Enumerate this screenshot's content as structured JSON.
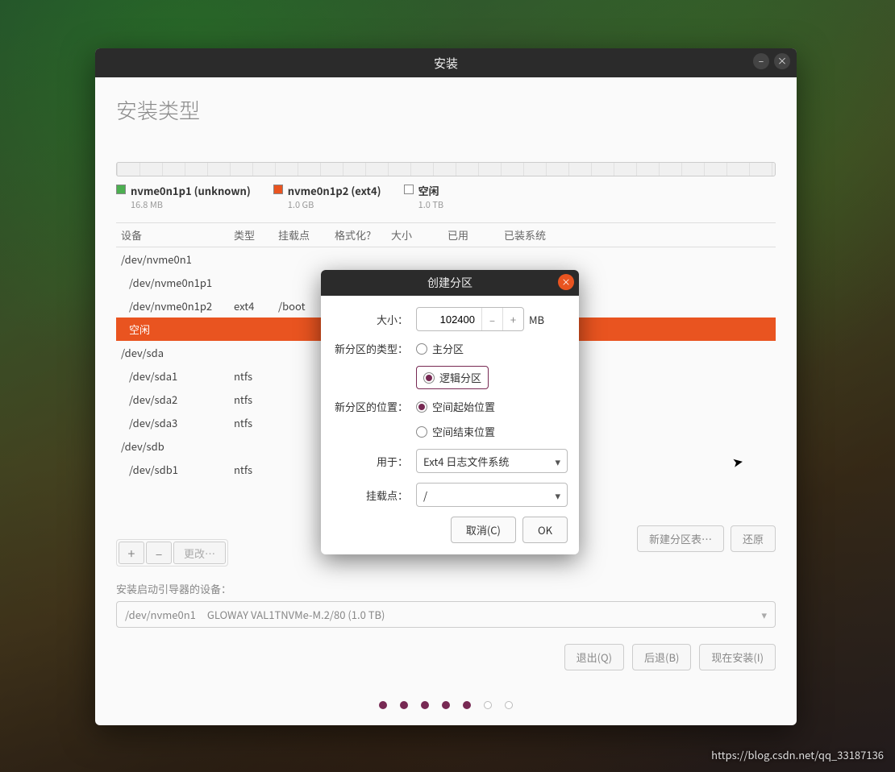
{
  "window": {
    "title": "安装",
    "minimize": "–",
    "close": "×"
  },
  "page": {
    "title": "安装类型"
  },
  "legend": [
    {
      "color": "green",
      "name": "nvme0n1p1 (unknown)",
      "size": "16.8 MB"
    },
    {
      "color": "orange",
      "name": "nvme0n1p2 (ext4)",
      "size": "1.0 GB"
    },
    {
      "color": "empty",
      "name": "空闲",
      "size": "1.0 TB"
    }
  ],
  "columns": {
    "device": "设备",
    "type": "类型",
    "mount": "挂载点",
    "format": "格式化?",
    "size": "大小",
    "used": "已用",
    "system": "已装系统"
  },
  "rows": [
    {
      "indent": 0,
      "device": "/dev/nvme0n1"
    },
    {
      "indent": 1,
      "device": "/dev/nvme0n1p1"
    },
    {
      "indent": 1,
      "device": "/dev/nvme0n1p2",
      "type": "ext4",
      "mount": "/boot"
    },
    {
      "indent": 1,
      "device": "空闲",
      "selected": true
    },
    {
      "indent": 0,
      "device": "/dev/sda"
    },
    {
      "indent": 1,
      "device": "/dev/sda1",
      "type": "ntfs"
    },
    {
      "indent": 1,
      "device": "/dev/sda2",
      "type": "ntfs"
    },
    {
      "indent": 1,
      "device": "/dev/sda3",
      "type": "ntfs"
    },
    {
      "indent": 0,
      "device": "/dev/sdb"
    },
    {
      "indent": 1,
      "device": "/dev/sdb1",
      "type": "ntfs"
    }
  ],
  "toolbar": {
    "plus": "+",
    "minus": "–",
    "change": "更改…",
    "new_table": "新建分区表…",
    "revert": "还原"
  },
  "bootloader": {
    "label": "安装启动引导器的设备：",
    "device": "/dev/nvme0n1",
    "desc": "GLOWAY VAL1TNVMe-M.2/80 (1.0 TB)"
  },
  "footer": {
    "quit": "退出(Q)",
    "back": "后退(B)",
    "install": "现在安装(I)"
  },
  "modal": {
    "title": "创建分区",
    "size_label": "大小：",
    "size_value": "102400",
    "size_unit": "MB",
    "type_label": "新分区的类型：",
    "type_primary": "主分区",
    "type_logical": "逻辑分区",
    "loc_label": "新分区的位置：",
    "loc_begin": "空间起始位置",
    "loc_end": "空间结束位置",
    "use_label": "用于：",
    "use_value": "Ext4 日志文件系统",
    "mount_label": "挂载点：",
    "mount_value": "/",
    "cancel": "取消(C)",
    "ok": "OK"
  },
  "watermark": "https://blog.csdn.net/qq_33187136"
}
